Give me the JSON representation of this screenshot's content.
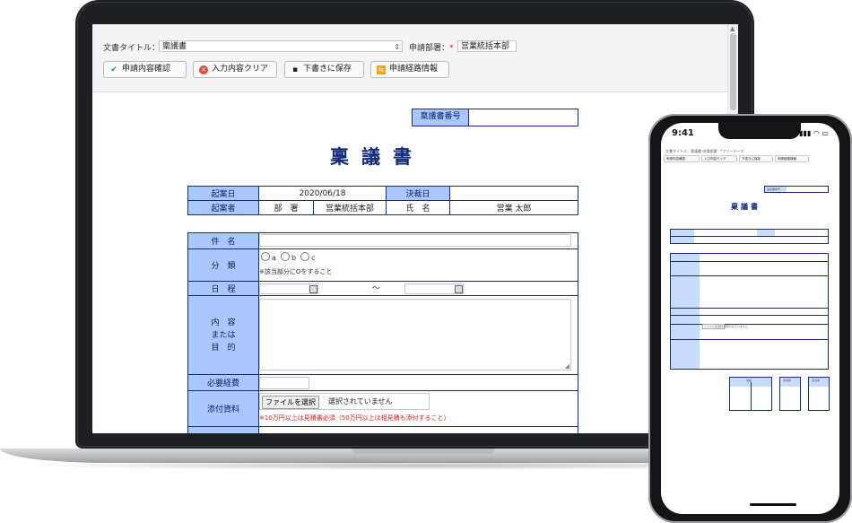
{
  "laptop": {
    "header": {
      "doc_title_label": "文書タイトル：",
      "doc_title_value": "稟議書",
      "dept_label": "申請部署：",
      "dept_required": "*",
      "dept_value": "営業統括本部"
    },
    "toolbar": {
      "confirm": "申請内容確認",
      "clear": "入力内容クリア",
      "save": "下書きに保存",
      "route": "申請経路情報"
    },
    "document": {
      "number_label": "稟議書番号",
      "number_value": "",
      "title": "稟議書",
      "info": {
        "start_date_label": "起案日",
        "start_date_value": "2020/06/18",
        "decision_date_label": "決裁日",
        "decision_date_value": "",
        "drafter_label": "起案者",
        "dept_label": "部　署",
        "dept_value": "営業統括本部",
        "name_label": "氏　名",
        "name_value": "営業 太郎"
      },
      "form": {
        "subject_label": "件　名",
        "category_label": "分　類",
        "category_options": [
          "a",
          "b",
          "c"
        ],
        "category_note": "※該当部分にOをすること",
        "schedule_label": "日　程",
        "schedule_sep": "～",
        "purpose_label_1": "内　容",
        "purpose_label_2": "または",
        "purpose_label_3": "目　的",
        "cost_label": "必要経費",
        "attach_label": "添付資料",
        "file_button": "ファイルを選択",
        "file_status": "選択されていません",
        "attach_note": "※10万円以上は見積書必須（50万円以上は相見積も添付すること）"
      }
    }
  },
  "phone": {
    "time": "9:41",
    "status_icons": "▮▮▮ ◠ ▭",
    "header_text": "文書タイトル：稟議書 申請部署：*フリーテーマ",
    "buttons": [
      "申請内容確認",
      "入力内容クリア",
      "下書きに保存",
      "申請経路情報"
    ],
    "number_label": "稟議書番号",
    "title": "稟議書",
    "file_button": "ファイルを選択",
    "file_status": "選択されていません",
    "approval_headers": [
      "決裁",
      "申請者",
      "担当者"
    ]
  }
}
